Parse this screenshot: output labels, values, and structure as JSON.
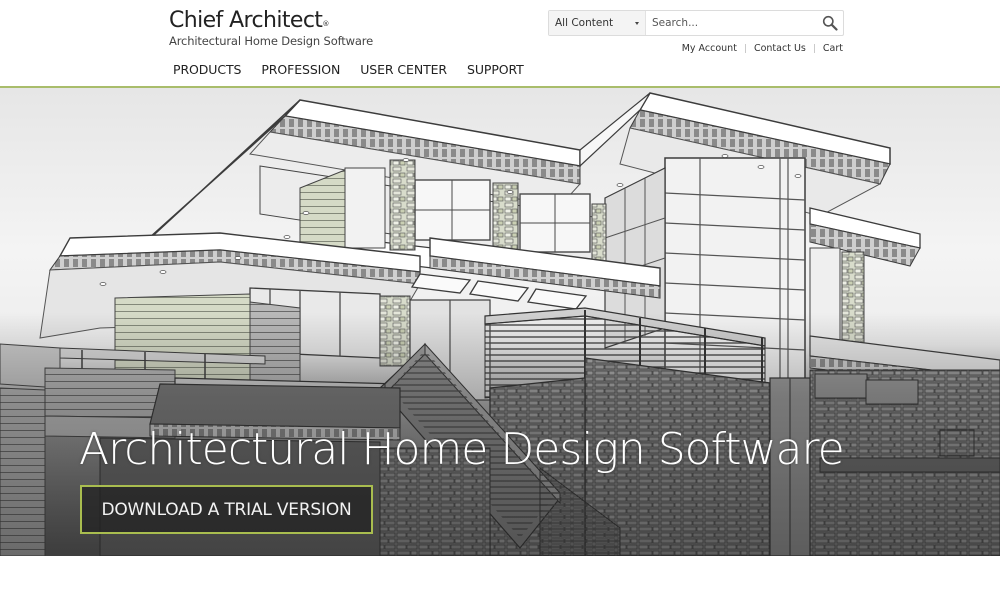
{
  "brand": {
    "name": "Chief Architect",
    "registered_mark": "®",
    "tagline": "Architectural Home Design Software",
    "accent_color": "#a9bd6b",
    "cta_border_color": "#a9bd4f"
  },
  "nav": {
    "items": [
      {
        "label": "PRODUCTS"
      },
      {
        "label": "PROFESSION"
      },
      {
        "label": "USER CENTER"
      },
      {
        "label": "SUPPORT"
      }
    ]
  },
  "search": {
    "scope_selected": "All Content",
    "placeholder": "Search...",
    "value": "",
    "button_icon": "magnifier-icon"
  },
  "utility_links": [
    {
      "label": "My Account"
    },
    {
      "label": "Contact Us"
    },
    {
      "label": "Cart"
    }
  ],
  "utility_separator": "|",
  "hero": {
    "image_subject": "architectural-house-rendering",
    "title": "Architectural Home Design Software",
    "cta_label": "DOWNLOAD A TRIAL VERSION"
  }
}
